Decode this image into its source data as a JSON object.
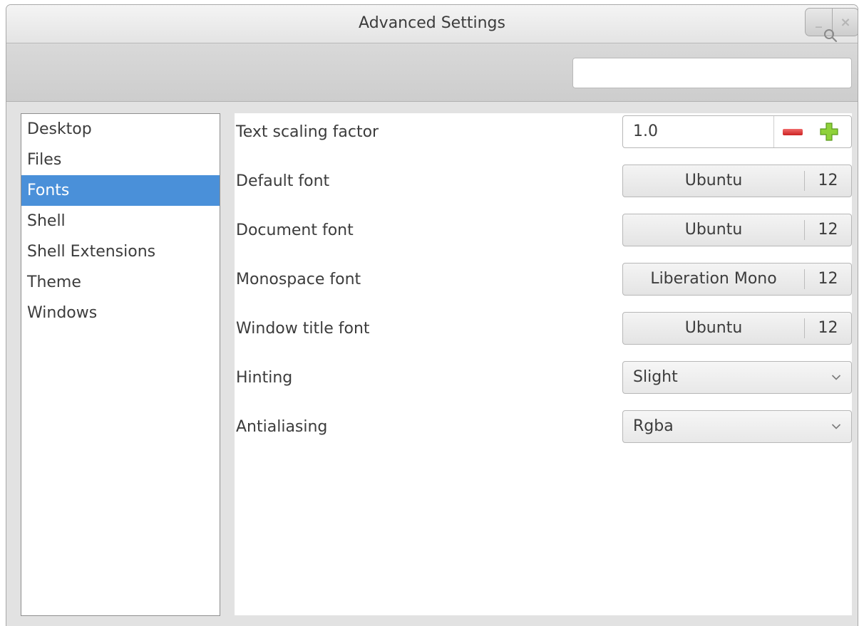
{
  "window": {
    "title": "Advanced Settings",
    "minimize_label": "_",
    "close_label": "×"
  },
  "search": {
    "placeholder": "",
    "value": ""
  },
  "sidebar": {
    "selected_index": 2,
    "items": [
      {
        "label": "Desktop"
      },
      {
        "label": "Files"
      },
      {
        "label": "Fonts"
      },
      {
        "label": "Shell"
      },
      {
        "label": "Shell Extensions"
      },
      {
        "label": "Theme"
      },
      {
        "label": "Windows"
      }
    ]
  },
  "fonts": {
    "text_scaling": {
      "label": "Text scaling factor",
      "value": "1.0"
    },
    "default_font": {
      "label": "Default font",
      "name": "Ubuntu",
      "size": "12"
    },
    "document_font": {
      "label": "Document font",
      "name": "Ubuntu",
      "size": "12"
    },
    "monospace_font": {
      "label": "Monospace font",
      "name": "Liberation Mono",
      "size": "12"
    },
    "window_title_font": {
      "label": "Window title font",
      "name": "Ubuntu",
      "size": "12"
    },
    "hinting": {
      "label": "Hinting",
      "value": "Slight"
    },
    "antialiasing": {
      "label": "Antialiasing",
      "value": "Rgba"
    }
  },
  "colors": {
    "selection": "#4a90d9",
    "minus": "#cc2222",
    "plus": "#7cbf2a"
  },
  "icons": {
    "search": "search-icon",
    "minus": "minus-icon",
    "plus": "plus-icon",
    "dropdown": "chevron-down-icon"
  }
}
